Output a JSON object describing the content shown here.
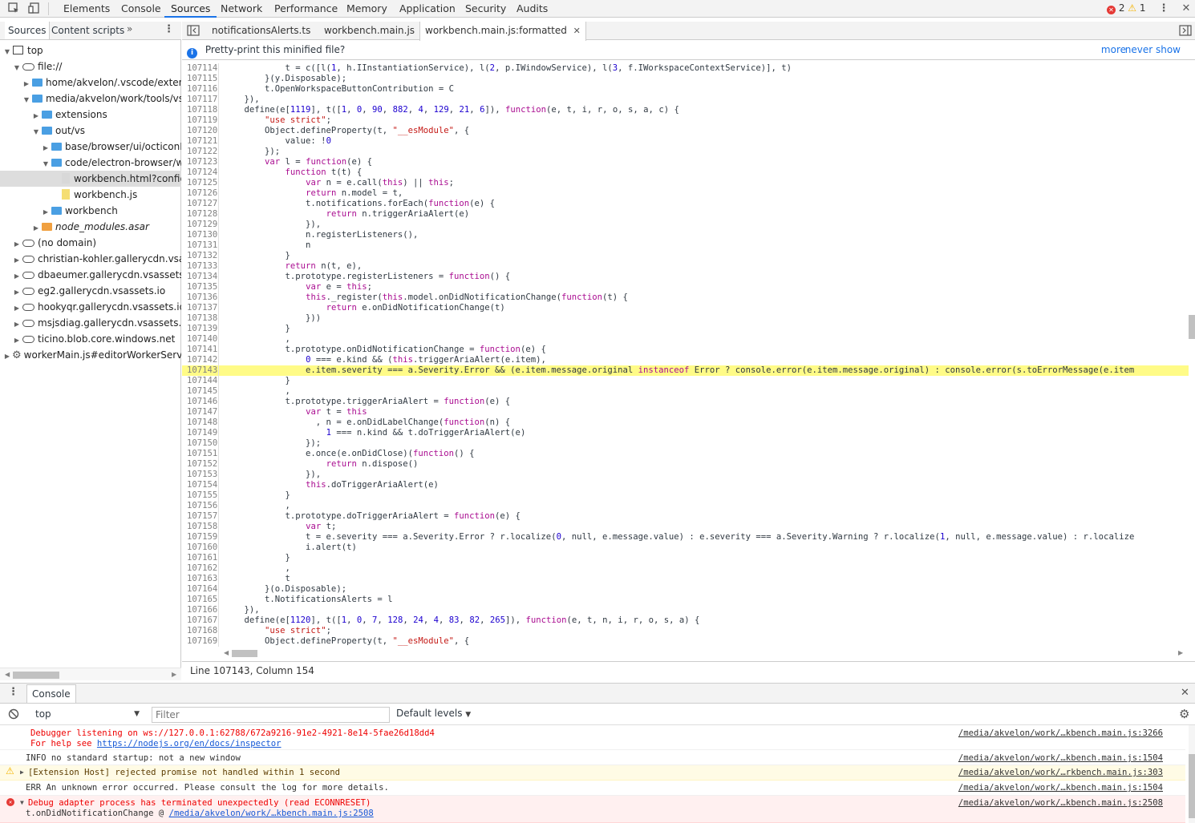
{
  "devtools": {
    "tabs": [
      "Elements",
      "Console",
      "Sources",
      "Network",
      "Performance",
      "Memory",
      "Application",
      "Security",
      "Audits"
    ],
    "active_tab": "Sources",
    "error_count": "2",
    "warning_count": "1"
  },
  "left": {
    "tabs": [
      "Sources",
      "Content scripts"
    ],
    "tree": [
      {
        "label": "top",
        "indent": 0,
        "arrow": "▼",
        "icon": "top"
      },
      {
        "label": "file://",
        "indent": 1,
        "arrow": "▼",
        "icon": "cloud"
      },
      {
        "label": "home/akvelon/.vscode/extens",
        "indent": 2,
        "arrow": "▶",
        "icon": "folder"
      },
      {
        "label": "media/akvelon/work/tools/vsc",
        "indent": 2,
        "arrow": "▼",
        "icon": "folder"
      },
      {
        "label": "extensions",
        "indent": 3,
        "arrow": "▶",
        "icon": "folder"
      },
      {
        "label": "out/vs",
        "indent": 3,
        "arrow": "▼",
        "icon": "folder"
      },
      {
        "label": "base/browser/ui/octiconL",
        "indent": 4,
        "arrow": "▶",
        "icon": "folder"
      },
      {
        "label": "code/electron-browser/w",
        "indent": 4,
        "arrow": "▼",
        "icon": "folder"
      },
      {
        "label": "workbench.html?config",
        "indent": 5,
        "arrow": "",
        "icon": "file",
        "selected": true
      },
      {
        "label": "workbench.js",
        "indent": 5,
        "arrow": "",
        "icon": "filejs"
      },
      {
        "label": "workbench",
        "indent": 4,
        "arrow": "▶",
        "icon": "folder"
      },
      {
        "label": "node_modules.asar",
        "indent": 3,
        "arrow": "▶",
        "icon": "folder-orange",
        "italic": true
      },
      {
        "label": "(no domain)",
        "indent": 1,
        "arrow": "▶",
        "icon": "cloud"
      },
      {
        "label": "christian-kohler.gallerycdn.vsass",
        "indent": 1,
        "arrow": "▶",
        "icon": "cloud"
      },
      {
        "label": "dbaeumer.gallerycdn.vsassets.io",
        "indent": 1,
        "arrow": "▶",
        "icon": "cloud"
      },
      {
        "label": "eg2.gallerycdn.vsassets.io",
        "indent": 1,
        "arrow": "▶",
        "icon": "cloud"
      },
      {
        "label": "hookyqr.gallerycdn.vsassets.io",
        "indent": 1,
        "arrow": "▶",
        "icon": "cloud"
      },
      {
        "label": "msjsdiag.gallerycdn.vsassets.io",
        "indent": 1,
        "arrow": "▶",
        "icon": "cloud"
      },
      {
        "label": "ticino.blob.core.windows.net",
        "indent": 1,
        "arrow": "▶",
        "icon": "cloud"
      },
      {
        "label": "workerMain.js#editorWorkerServic",
        "indent": 0,
        "arrow": "▶",
        "icon": "gear"
      }
    ]
  },
  "editor": {
    "tabs": [
      "notificationsAlerts.ts",
      "workbench.main.js",
      "workbench.main.js:formatted"
    ],
    "active_tab_index": 2,
    "prettyprint_text": "Pretty-print this minified file?",
    "more_link": "more",
    "never_show_link": "never show",
    "status_line": "Line 107143, Column 154",
    "highlight_line": "107143",
    "lines": [
      [
        "107114",
        "            t = c([l(1, h.IInstantiationService), l(2, p.IWindowService), l(3, f.IWorkspaceContextService)], t)"
      ],
      [
        "107115",
        "        }(y.Disposable);"
      ],
      [
        "107116",
        "        t.OpenWorkspaceButtonContribution = C"
      ],
      [
        "107117",
        "    }),"
      ],
      [
        "107118",
        "    define(e[1119], t([1, 0, 90, 882, 4, 129, 21, 6]), function(e, t, i, r, o, s, a, c) {"
      ],
      [
        "107119",
        "        \"use strict\";"
      ],
      [
        "107120",
        "        Object.defineProperty(t, \"__esModule\", {"
      ],
      [
        "107121",
        "            value: !0"
      ],
      [
        "107122",
        "        });"
      ],
      [
        "107123",
        "        var l = function(e) {"
      ],
      [
        "107124",
        "            function t(t) {"
      ],
      [
        "107125",
        "                var n = e.call(this) || this;"
      ],
      [
        "107126",
        "                return n.model = t,"
      ],
      [
        "107127",
        "                t.notifications.forEach(function(e) {"
      ],
      [
        "107128",
        "                    return n.triggerAriaAlert(e)"
      ],
      [
        "107129",
        "                }),"
      ],
      [
        "107130",
        "                n.registerListeners(),"
      ],
      [
        "107131",
        "                n"
      ],
      [
        "107132",
        "            }"
      ],
      [
        "107133",
        "            return n(t, e),"
      ],
      [
        "107134",
        "            t.prototype.registerListeners = function() {"
      ],
      [
        "107135",
        "                var e = this;"
      ],
      [
        "107136",
        "                this._register(this.model.onDidNotificationChange(function(t) {"
      ],
      [
        "107137",
        "                    return e.onDidNotificationChange(t)"
      ],
      [
        "107138",
        "                }))"
      ],
      [
        "107139",
        "            }"
      ],
      [
        "107140",
        "            ,"
      ],
      [
        "107141",
        "            t.prototype.onDidNotificationChange = function(e) {"
      ],
      [
        "107142",
        "                0 === e.kind && (this.triggerAriaAlert(e.item),"
      ],
      [
        "107143",
        "                e.item.severity === a.Severity.Error && (e.item.message.original instanceof Error ? console.error(e.item.message.original) : console.error(s.toErrorMessage(e.item"
      ],
      [
        "107144",
        "            }"
      ],
      [
        "107145",
        "            ,"
      ],
      [
        "107146",
        "            t.prototype.triggerAriaAlert = function(e) {"
      ],
      [
        "107147",
        "                var t = this"
      ],
      [
        "107148",
        "                  , n = e.onDidLabelChange(function(n) {"
      ],
      [
        "107149",
        "                    1 === n.kind && t.doTriggerAriaAlert(e)"
      ],
      [
        "107150",
        "                });"
      ],
      [
        "107151",
        "                e.once(e.onDidClose)(function() {"
      ],
      [
        "107152",
        "                    return n.dispose()"
      ],
      [
        "107153",
        "                }),"
      ],
      [
        "107154",
        "                this.doTriggerAriaAlert(e)"
      ],
      [
        "107155",
        "            }"
      ],
      [
        "107156",
        "            ,"
      ],
      [
        "107157",
        "            t.prototype.doTriggerAriaAlert = function(e) {"
      ],
      [
        "107158",
        "                var t;"
      ],
      [
        "107159",
        "                t = e.severity === a.Severity.Error ? r.localize(0, null, e.message.value) : e.severity === a.Severity.Warning ? r.localize(1, null, e.message.value) : r.localize"
      ],
      [
        "107160",
        "                i.alert(t)"
      ],
      [
        "107161",
        "            }"
      ],
      [
        "107162",
        "            ,"
      ],
      [
        "107163",
        "            t"
      ],
      [
        "107164",
        "        }(o.Disposable);"
      ],
      [
        "107165",
        "        t.NotificationsAlerts = l"
      ],
      [
        "107166",
        "    }),"
      ],
      [
        "107167",
        "    define(e[1120], t([1, 0, 7, 128, 24, 4, 83, 82, 265]), function(e, t, n, i, r, o, s, a) {"
      ],
      [
        "107168",
        "        \"use strict\";"
      ],
      [
        "107169",
        "        Object.defineProperty(t, \"__esModule\", {"
      ],
      [
        "107170",
        ""
      ]
    ]
  },
  "console": {
    "tab": "Console",
    "context": "top",
    "filter_placeholder": "Filter",
    "levels": "Default levels",
    "messages": [
      {
        "type": "err-plain",
        "text": "Debugger listening on ws://127.0.0.1:62788/672a9216-91e2-4921-8e14-5fae26d18dd4",
        "text2_prefix": "For help see ",
        "text2_link": "https://nodejs.org/en/docs/inspector",
        "src": "/media/akvelon/work/…kbench.main.js:3266"
      },
      {
        "type": "info",
        "text": "INFO no standard startup: not a new window",
        "src": "/media/akvelon/work/…kbench.main.js:1504"
      },
      {
        "type": "warn",
        "text": "[Extension Host] rejected promise not handled within 1 second",
        "src": "/media/akvelon/work/…rkbench.main.js:303"
      },
      {
        "type": "info",
        "text": "ERR An unknown error occurred. Please consult the log for more details.",
        "src": "/media/akvelon/work/…kbench.main.js:1504"
      },
      {
        "type": "err",
        "text": "Debug adapter process has terminated unexpectedly (read ECONNRESET)",
        "text2_prefix": "t.onDidNotificationChange @ ",
        "text2_link": "/media/akvelon/work/…kbench.main.js:2508",
        "src": "/media/akvelon/work/…kbench.main.js:2508"
      }
    ]
  }
}
